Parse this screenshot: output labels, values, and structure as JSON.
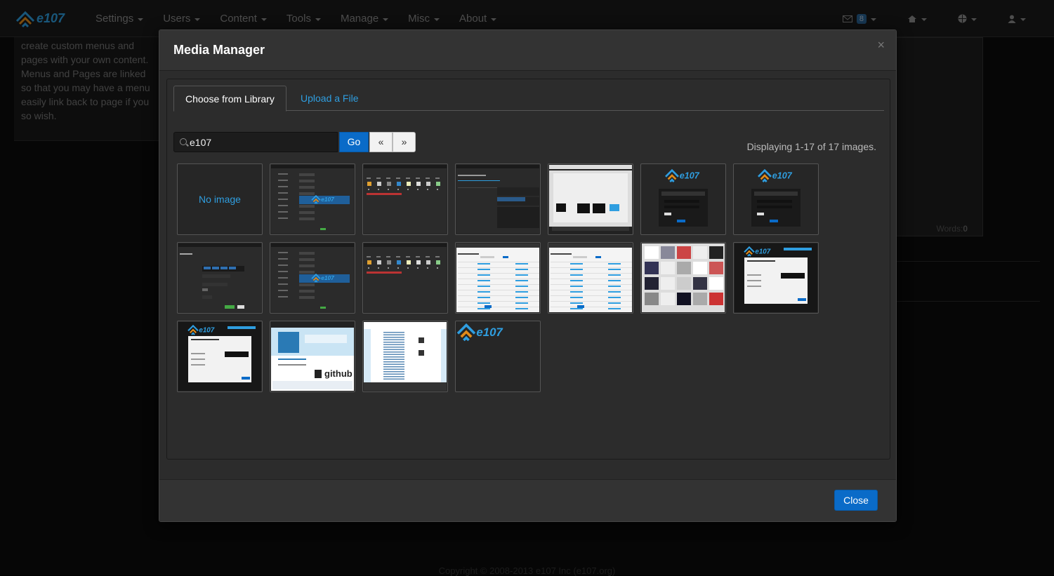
{
  "navbar": {
    "logo_text": "e107",
    "menu": [
      "Settings",
      "Users",
      "Content",
      "Tools",
      "Manage",
      "Misc",
      "About"
    ],
    "mail_count": "8"
  },
  "background": {
    "side_text": "create custom menus and pages with your own content. Menus and Pages are linked so that you may have a menu easily link back to page if you so wish.",
    "words_label": "Words:",
    "words_count": "0",
    "footer": "Copyright © 2008-2013 e107 Inc (e107.org)"
  },
  "modal": {
    "title": "Media Manager",
    "close_x": "×",
    "tabs": {
      "library": "Choose from Library",
      "upload": "Upload a File"
    },
    "search": {
      "value": "e107",
      "go_label": "Go",
      "prev_label": "«",
      "next_label": "»"
    },
    "display_count": "Displaying 1-17 of 17 images.",
    "no_image_label": "No image",
    "github_label": "github",
    "e107_logo": "e107",
    "close_button": "Close"
  },
  "thumbnails": [
    {
      "kind": "no-image"
    },
    {
      "kind": "admin-form"
    },
    {
      "kind": "icon-row"
    },
    {
      "kind": "manage-form"
    },
    {
      "kind": "light-window"
    },
    {
      "kind": "login-dark"
    },
    {
      "kind": "login-dark"
    },
    {
      "kind": "admin-small"
    },
    {
      "kind": "admin-form"
    },
    {
      "kind": "icon-row"
    },
    {
      "kind": "table-light"
    },
    {
      "kind": "table-light"
    },
    {
      "kind": "collage"
    },
    {
      "kind": "login-light"
    },
    {
      "kind": "login-light"
    },
    {
      "kind": "github-site"
    },
    {
      "kind": "blue-site"
    },
    {
      "kind": "logo"
    }
  ],
  "colors": {
    "accent": "#0a6bc8",
    "link": "#2f9ee0",
    "modal_bg": "#2c2c2c"
  }
}
